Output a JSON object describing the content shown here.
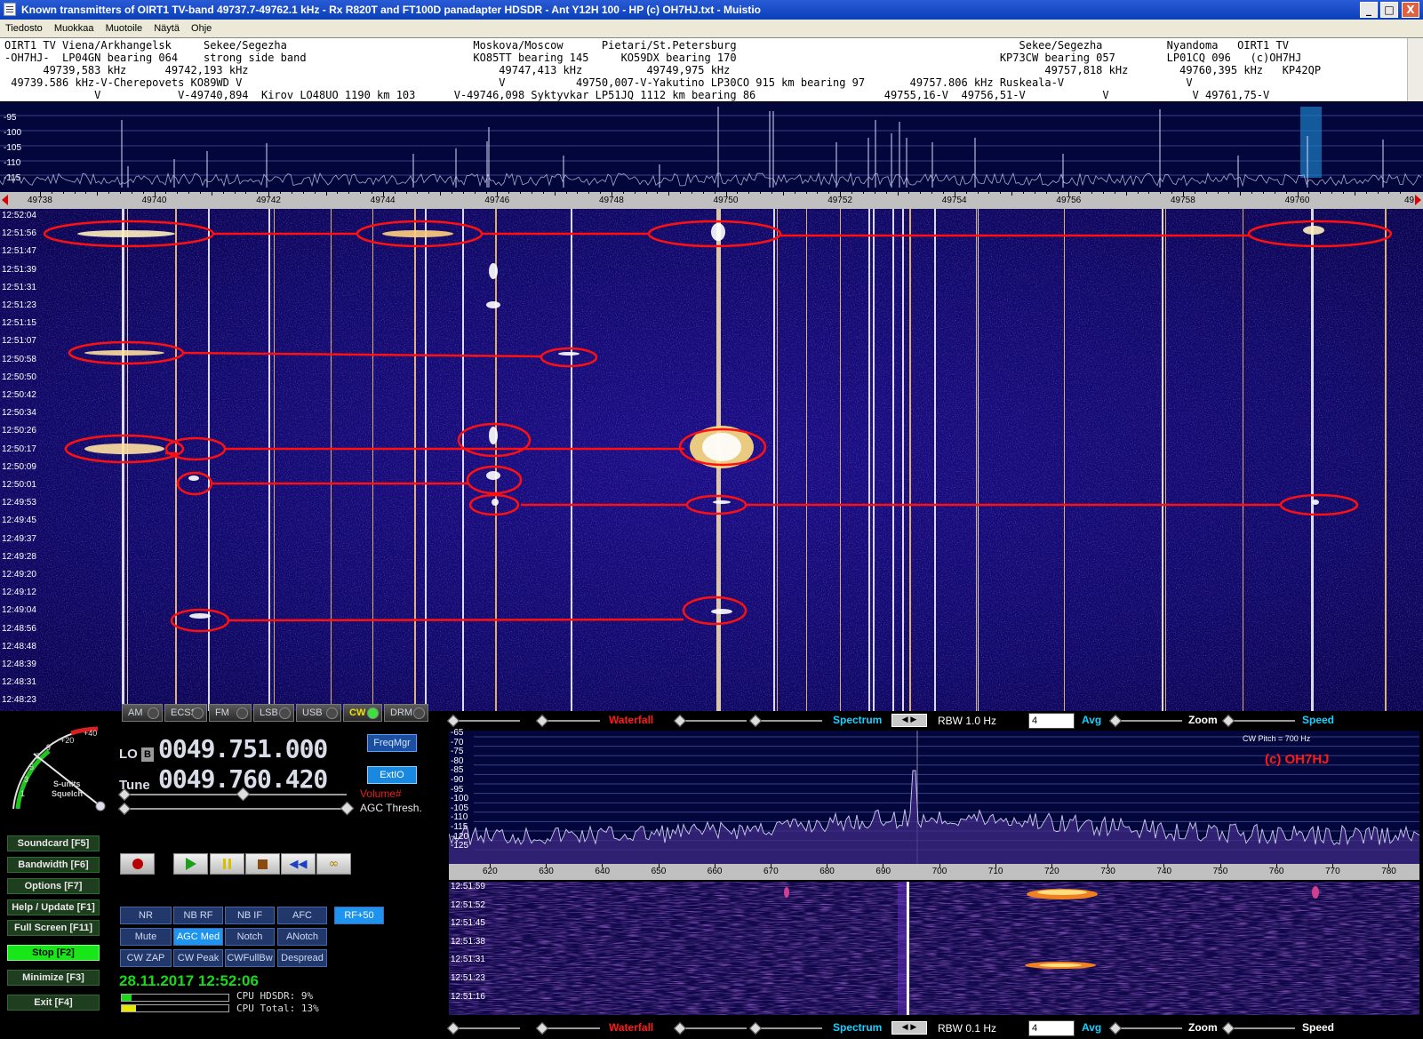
{
  "window": {
    "title": "Known transmitters of OIRT1 TV-band 49737.7-49762.1 kHz - Rx R820T and FT100D panadapter HDSDR - Ant Y12H 100 - HP (c) OH7HJ.txt - Muistio",
    "minimize": "_",
    "maximize": "□",
    "close": "X"
  },
  "menu": [
    "Tiedosto",
    "Muokkaa",
    "Muotoile",
    "Näytä",
    "Ohje"
  ],
  "notepad": {
    "lines": [
      "OIRT1 TV Viena/Arkhangelsk     Sekee/Segezha                             Moskova/Moscow      Pietari/St.Petersburg                                            Sekee/Segezha          Nyandoma   OIRT1 TV",
      "-OH7HJ-  LP04GN bearing 064    strong side band                          KO85TT bearing 145     KO59DX bearing 170                                         KP73CW bearing 057        LP01CQ 096   (c)OH7HJ",
      "      49739,583 kHz      49742,193 kHz                                       49747,413 kHz          49749,975 kHz                                                 49757,818 kHz        49760,395 kHz   KP42QP",
      " 49739.586 kHz-V-Cherepovets KO89WD V                                        V           49750,007-V-Yakutino LP30CO 915 km bearing 97       49757.806 kHz Ruskeala-V                   V",
      "              V            V-49740,894  Kirov LO48UO 1190 km 103      V-49746,098 Syktyvkar LP51JQ 1112 km bearing 86                    49755,16-V  49756,51-V            V             V 49761,75-V"
    ]
  },
  "freq_scale": {
    "ticks": [
      "49738",
      "49740",
      "49742",
      "49744",
      "49746",
      "49748",
      "49750",
      "49752",
      "49754",
      "49756",
      "49758",
      "49760"
    ],
    "edge_right": "49"
  },
  "spectrum_top": {
    "db_labels": [
      "-95",
      "-100",
      "-105",
      "-110",
      "-115"
    ]
  },
  "waterfall": {
    "times": [
      "12:52:04",
      "12:51:56",
      "12:51:47",
      "12:51:39",
      "12:51:31",
      "12:51:23",
      "12:51:15",
      "12:51:07",
      "12:50:58",
      "12:50:50",
      "12:50:42",
      "12:50:34",
      "12:50:26",
      "12:50:17",
      "12:50:09",
      "12:50:01",
      "12:49:53",
      "12:49:45",
      "12:49:37",
      "12:49:28",
      "12:49:20",
      "12:49:12",
      "12:49:04",
      "12:48:56",
      "12:48:48",
      "12:48:39",
      "12:48:31",
      "12:48:23"
    ]
  },
  "control_bar_top": {
    "waterfall": "Waterfall",
    "spectrum": "Spectrum",
    "rbw": "RBW  1.0 Hz",
    "avg_value": "4",
    "avg": "Avg",
    "zoom": "Zoom",
    "speed": "Speed"
  },
  "control_bar_bottom": {
    "waterfall": "Waterfall",
    "spectrum": "Spectrum",
    "rbw": "RBW  0.1 Hz",
    "avg_value": "4",
    "avg": "Avg",
    "zoom": "Zoom",
    "speed": "Speed"
  },
  "smeter": {
    "scale": [
      "1",
      "3",
      "5",
      "7",
      "9",
      "+20",
      "+40"
    ],
    "label1": "S-units",
    "label2": "Squelch"
  },
  "modes": [
    "AM",
    "ECSS",
    "FM",
    "LSB",
    "USB",
    "CW",
    "DRM"
  ],
  "active_mode": "CW",
  "lo": {
    "label": "LO",
    "b": "B",
    "value": "0049.751.000"
  },
  "tune": {
    "label": "Tune",
    "value": "0049.760.420"
  },
  "buttons": {
    "freqmgr": "FreqMgr",
    "extio": "ExtIO",
    "volume": "Volume#",
    "agc_thresh": "AGC Thresh."
  },
  "fkeys": [
    "Soundcard  [F5]",
    "Bandwidth  [F6]",
    "Options  [F7]",
    "Help / Update  [F1]",
    "Full Screen  [F11]",
    "Stop        [F2]",
    "Minimize  [F3]",
    "Exit        [F4]"
  ],
  "dsp_row1": [
    "NR",
    "NB RF",
    "NB IF",
    "AFC",
    "RF+50"
  ],
  "dsp_row2": [
    "Mute",
    "AGC Med",
    "Notch",
    "ANotch"
  ],
  "dsp_row3": [
    "CW ZAP",
    "CW Peak",
    "CWFullBw",
    "Despread"
  ],
  "datetime": "28.11.2017 12:52:06",
  "cpu": {
    "hdsdr_label": "CPU  HDSDR:",
    "hdsdr_value": "9%",
    "hdsdr_level": 0.09,
    "total_label": "CPU  Total:",
    "total_value": "13%",
    "total_level": 0.13
  },
  "audio_spectrum": {
    "db_labels": [
      "-65",
      "-70",
      "-75",
      "-80",
      "-85",
      "-90",
      "-95",
      "-100",
      "-105",
      "-110",
      "-115",
      "-120",
      "-125"
    ],
    "x_ticks": [
      "620",
      "630",
      "640",
      "650",
      "660",
      "670",
      "680",
      "690",
      "700",
      "710",
      "720",
      "730",
      "740",
      "750",
      "760",
      "770",
      "780"
    ],
    "cw_pitch": "CW Pitch = 700 Hz",
    "copyright": "(c) OH7HJ"
  },
  "audio_waterfall": {
    "times": [
      "12:51:59",
      "12:51:52",
      "12:51:45",
      "12:51:38",
      "12:51:31",
      "12:51:23",
      "12:51:16"
    ]
  },
  "colors": {
    "title_blue": "#0a3fb8",
    "waterfall_bg": "#120a6c",
    "annotation_red": "#ff0000",
    "label_cyan": "#17d0ff",
    "date_green": "#19d919",
    "stop_green": "#19e619"
  }
}
